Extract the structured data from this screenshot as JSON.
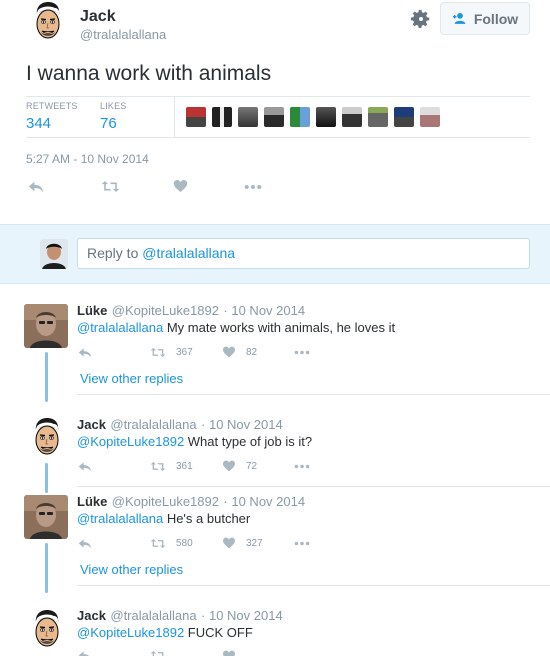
{
  "tweet": {
    "author_name": "Jack",
    "author_handle": "@tralalalallana",
    "follow_label": "Follow",
    "text": "I wanna work with animals",
    "retweets_label": "RETWEETS",
    "retweets_count": "344",
    "likes_label": "LIKES",
    "likes_count": "76",
    "timestamp": "5:27 AM - 10 Nov 2014"
  },
  "reply_box": {
    "prefix": "Reply to ",
    "mention": "@tralalalallana"
  },
  "replies": [
    {
      "name": "Lüke",
      "handle": "@KopiteLuke1892",
      "date": "· 10 Nov 2014",
      "mention": "@tralalalallana",
      "text": " My mate works with animals, he loves it",
      "retweets": "367",
      "likes": "82"
    },
    {
      "name": "Jack",
      "handle": "@tralalalallana",
      "date": "· 10 Nov 2014",
      "mention": "@KopiteLuke1892",
      "text": " What type of job is it?",
      "retweets": "361",
      "likes": "72"
    },
    {
      "name": "Lüke",
      "handle": "@KopiteLuke1892",
      "date": "· 10 Nov 2014",
      "mention": "@tralalalallana",
      "text": " He's a butcher",
      "retweets": "580",
      "likes": "327"
    },
    {
      "name": "Jack",
      "handle": "@tralalalallana",
      "date": "· 10 Nov 2014",
      "mention": "@KopiteLuke1892",
      "text": " FUCK OFF"
    }
  ],
  "view_other_replies": "View other replies",
  "colors": {
    "accent": "#1b95e0",
    "muted": "#8899a6",
    "thread_line": "#8dbde9",
    "reply_panel_bg": "#e8f4fb"
  },
  "icons": [
    "gear-icon",
    "follow-person-icon",
    "reply-icon",
    "retweet-icon",
    "like-icon",
    "more-icon"
  ]
}
